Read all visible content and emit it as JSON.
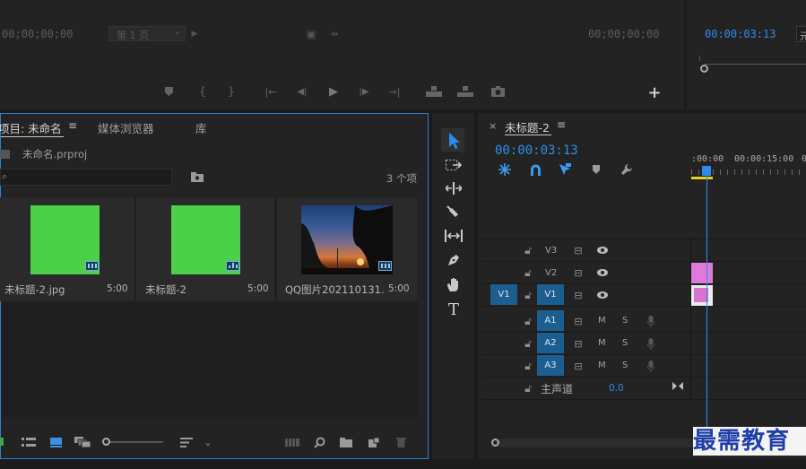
{
  "source_monitor": {
    "timecode_left": "00;00;00;00",
    "page_selector": "第 1 页",
    "timecode_right": "00;00;00;00"
  },
  "program_monitor": {
    "timecode": "00:00:03:13",
    "fit_label": "元"
  },
  "project_panel": {
    "tabs": [
      "项目: 未命名",
      "媒体浏览器",
      "库"
    ],
    "menu_icon": "hamburger-icon",
    "project_file": "未命名.prproj",
    "item_count": "3 个项",
    "items": [
      {
        "name": "未标题-2.jpg",
        "duration": "5:00",
        "color": "#4cd04a",
        "badge": "image"
      },
      {
        "name": "未标题-2",
        "duration": "5:00",
        "color": "#4cd04a",
        "badge": "sequence"
      },
      {
        "name": "QQ图片202110131...",
        "duration": "5:00",
        "badge": "image"
      }
    ]
  },
  "timeline": {
    "tab_title": "未标题-2",
    "close_label": "×",
    "menu_label": "≡",
    "timecode": "00:00:03:13",
    "ruler": [
      ":00:00",
      "00:00:15:00",
      "0"
    ],
    "video_tracks": [
      {
        "name": "V3",
        "source_patch": ""
      },
      {
        "name": "V2",
        "source_patch": ""
      },
      {
        "name": "V1",
        "source_patch": "V1"
      }
    ],
    "audio_tracks": [
      {
        "name": "A1",
        "mute": "M",
        "solo": "S"
      },
      {
        "name": "A2",
        "mute": "M",
        "solo": "S"
      },
      {
        "name": "A3",
        "mute": "M",
        "solo": "S"
      }
    ],
    "master": {
      "label": "主声道",
      "value": "0.0"
    }
  },
  "watermark": "最需教育",
  "colors": {
    "accent_blue": "#2d8ceb",
    "track_blue": "#1d5e90",
    "clip_pink": "#e07ad8",
    "green_thumb": "#4cd04a"
  }
}
